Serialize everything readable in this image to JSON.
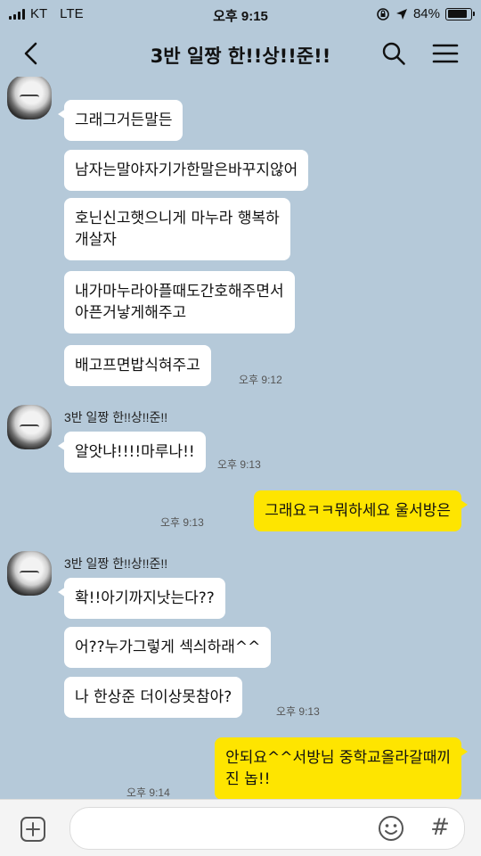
{
  "status_bar": {
    "carrier": "KT",
    "network": "LTE",
    "time": "오후 9:15",
    "battery": "84%",
    "battery_level": 0.84
  },
  "header": {
    "title": "3반 일짱 한!!상!!준!!"
  },
  "chat": {
    "sender_name": "3반 일짱 한!!상!!준!!",
    "messages": [
      {
        "text": "그래그거든말든"
      },
      {
        "text": "남자는말야자기가한말은바꾸지않어"
      },
      {
        "text": "호닌신고햇으니게 마누라 행복하\n개살자"
      },
      {
        "text": "내가마누라아플때도간호해주면서\n아픈거낳게해주고"
      },
      {
        "text": "배고프면밥식혀주고",
        "time": "오후 9:12"
      },
      {
        "text": "알앗냐!!!!마루나!!",
        "time": "오후 9:13"
      },
      {
        "text": "그래요ㅋㅋ뭐하세요 울서방은",
        "time": "오후 9:13"
      },
      {
        "text": "확!!아기까지낫는다??"
      },
      {
        "text": "어??누가그렇게 섹싀하래^^"
      },
      {
        "text": "나 한상준 더이상못참아?",
        "time": "오후 9:13"
      },
      {
        "text": "안되요^^서방님 중학교올라갈때끼\n진 놉!!",
        "time": "오후 9:14"
      }
    ]
  },
  "input_bar": {
    "placeholder": "",
    "hash_label": "#"
  },
  "colors": {
    "background": "#b5c9d9",
    "incoming_bubble": "#ffffff",
    "outgoing_bubble": "#fee500"
  }
}
